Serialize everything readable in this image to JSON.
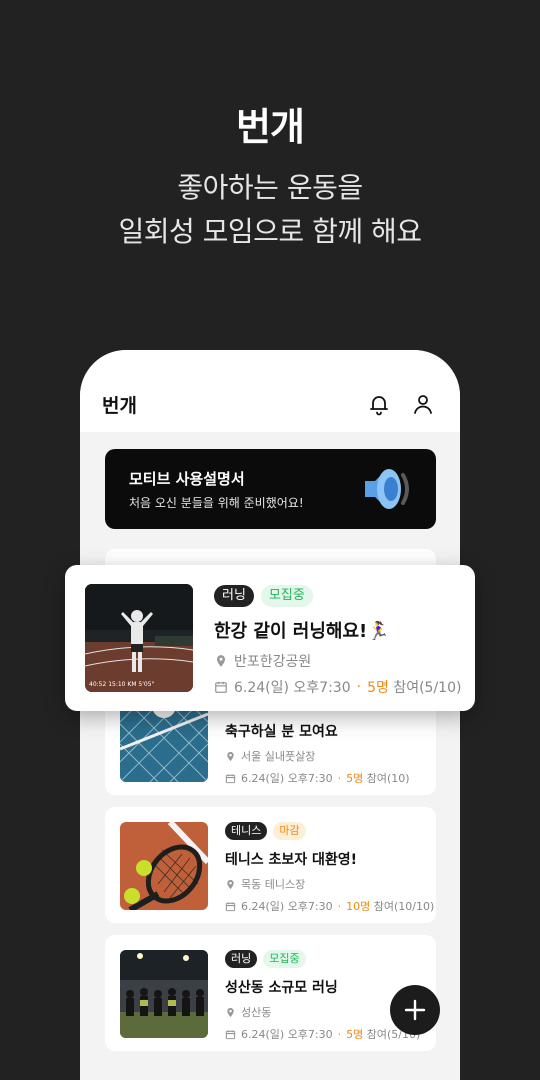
{
  "promo": {
    "title": "번개",
    "subtitle_line1": "좋아하는 운동을",
    "subtitle_line2": "일회성 모임으로 함께 해요"
  },
  "app": {
    "title": "번개",
    "icons": [
      "bell-icon",
      "user-icon"
    ]
  },
  "banner": {
    "title": "모티브 사용설명서",
    "subtitle": "처음 오신 분들을 위해 준비했어요!",
    "icon": "speaker-icon"
  },
  "featured": {
    "tags": [
      "러닝",
      "모집중"
    ],
    "title": "한강 같이 러닝해요!🏃‍♀️",
    "location": "반포한강공원",
    "time": "6.24(일) 오후7:30",
    "count": "5명",
    "participation": "참여(5/10)",
    "photo_overlay": "40:52   15:10 KM   5'05\""
  },
  "cards": [
    {
      "tags": [],
      "title": "축구하실 분 모여요",
      "location": "서울 실내풋살장",
      "time": "6.24(일) 오후7:30",
      "count": "5명",
      "participation": "참여(10)"
    },
    {
      "tags": [
        "테니스",
        "마감"
      ],
      "title": "테니스 초보자 대환영!",
      "location": "목동 테니스장",
      "time": "6.24(일) 오후7:30",
      "count": "10명",
      "participation": "참여(10/10)"
    },
    {
      "tags": [
        "러닝",
        "모집중"
      ],
      "title": "성산동 소규모 러닝",
      "location": "성산동",
      "time": "6.24(일) 오후7:30",
      "count": "5명",
      "participation": "참여(5/10)"
    }
  ],
  "separator": "·",
  "fab_icon": "plus-icon",
  "colors": {
    "background": "#222222",
    "highlight": "#ef8a17",
    "recruiting": "#22b35a",
    "closed": "#ef8a17"
  }
}
